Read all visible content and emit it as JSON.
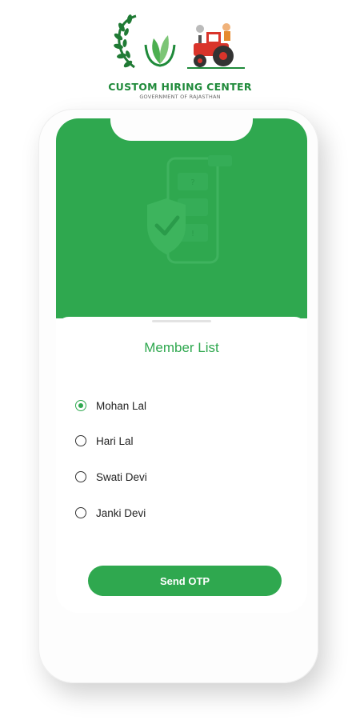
{
  "brand": {
    "title": "CUSTOM HIRING CENTER",
    "subtitle": "GOVERNMENT OF RAJASTHAN",
    "color": "#1f8a3a"
  },
  "app": {
    "accent": "#2fa84f",
    "list_title": "Member List",
    "selected_index": 0,
    "members": [
      {
        "label": "Mohan Lal",
        "checked": true
      },
      {
        "label": "Hari Lal",
        "checked": false
      },
      {
        "label": "Swati Devi",
        "checked": false
      },
      {
        "label": "Janki Devi",
        "checked": false
      }
    ],
    "send_button": "Send OTP"
  },
  "icons": {
    "logo": "wheat-leaf-tractor-logo",
    "hero": "phone-shield-check-illustration"
  }
}
